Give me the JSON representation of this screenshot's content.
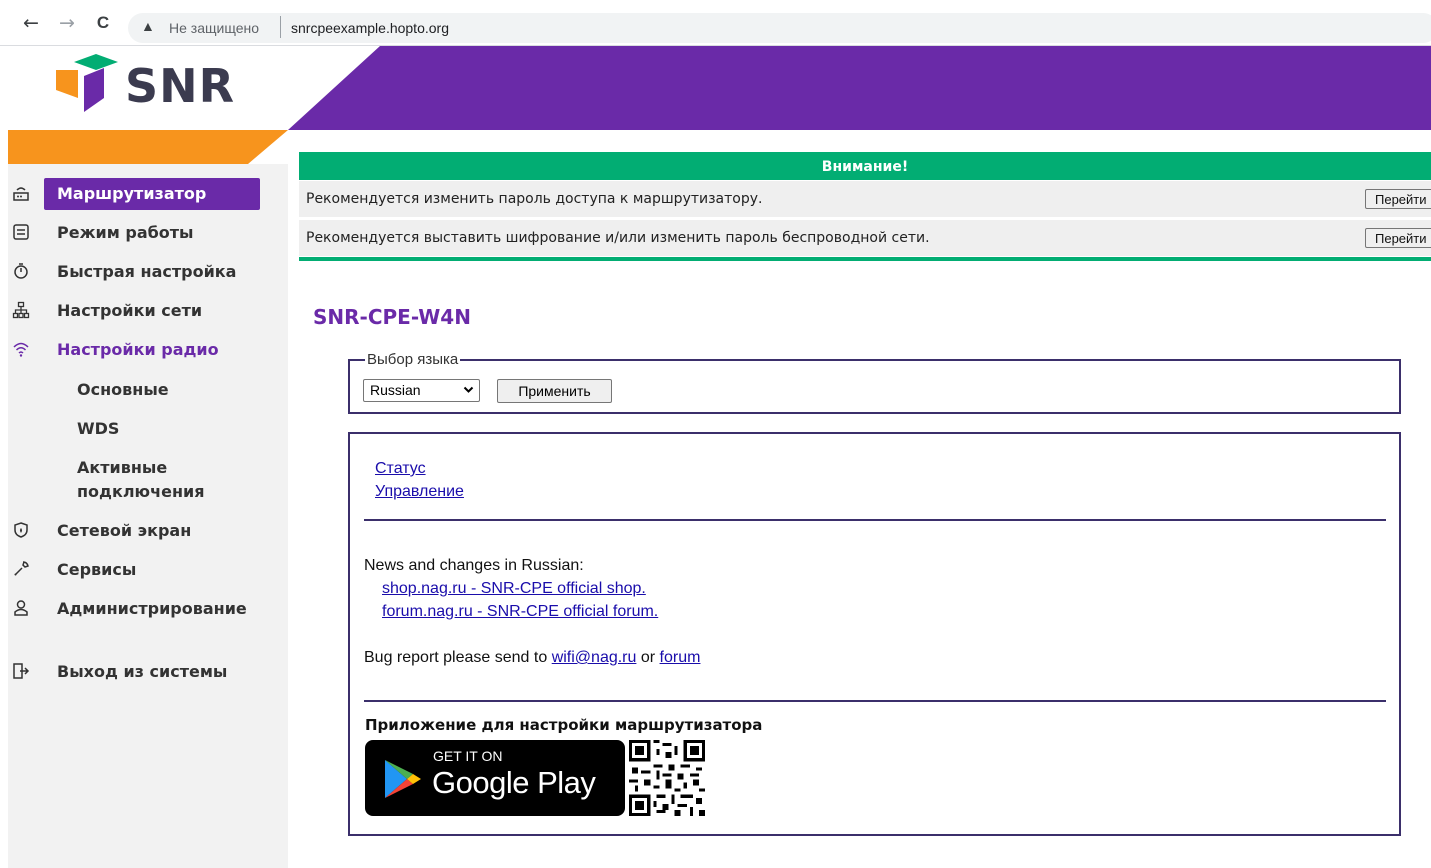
{
  "browser": {
    "back_icon": "←",
    "forward_icon": "→",
    "reload_icon": "C",
    "warning_icon": "▲",
    "security_label": "Не защищено",
    "url": "snrcpeexample.hopto.org"
  },
  "header": {
    "logo_text": "SNR",
    "colors": {
      "purple": "#6a2aa8",
      "orange": "#f7941d",
      "green": "#02ad73"
    }
  },
  "sidebar": {
    "items": [
      {
        "label": "Маршрутизатор",
        "icon": "router-icon"
      },
      {
        "label": "Режим работы",
        "icon": "mode-icon"
      },
      {
        "label": "Быстрая настройка",
        "icon": "stopwatch-icon"
      },
      {
        "label": "Настройки сети",
        "icon": "network-icon"
      },
      {
        "label": "Настройки радио",
        "icon": "wifi-icon"
      },
      {
        "label": "Сетевой экран",
        "icon": "shield-icon"
      },
      {
        "label": "Сервисы",
        "icon": "wrench-icon"
      },
      {
        "label": "Администрирование",
        "icon": "admin-icon"
      },
      {
        "label": "Выход из системы",
        "icon": "logout-icon"
      }
    ],
    "radio_submenu": [
      "Основные",
      "WDS",
      "Активные",
      "подключения"
    ]
  },
  "alert": {
    "title": "Внимание!",
    "rows": [
      {
        "text": "Рекомендуется изменить пароль доступа к маршрутизатору.",
        "button": "Перейти"
      },
      {
        "text": "Рекомендуется выставить шифрование и/или изменить пароль беспроводной сети.",
        "button": "Перейти"
      }
    ]
  },
  "main": {
    "device_title": "SNR-CPE-W4N",
    "language": {
      "legend": "Выбор языка",
      "selected": "Russian",
      "apply_label": "Применить"
    },
    "links": {
      "status": "Статус",
      "management": "Управление"
    },
    "news": {
      "heading": "News and changes in Russian:",
      "shop": "shop.nag.ru - SNR-CPE official shop.",
      "forum": "forum.nag.ru - SNR-CPE official forum."
    },
    "bug": {
      "prefix": "Bug report please send to",
      "email": "wifi@nag.ru",
      "or": "or",
      "forum_link": "forum"
    },
    "app": {
      "title": "Приложение для настройки маршрутизатора",
      "badge_small": "GET IT ON",
      "badge_big": "Google Play"
    }
  }
}
